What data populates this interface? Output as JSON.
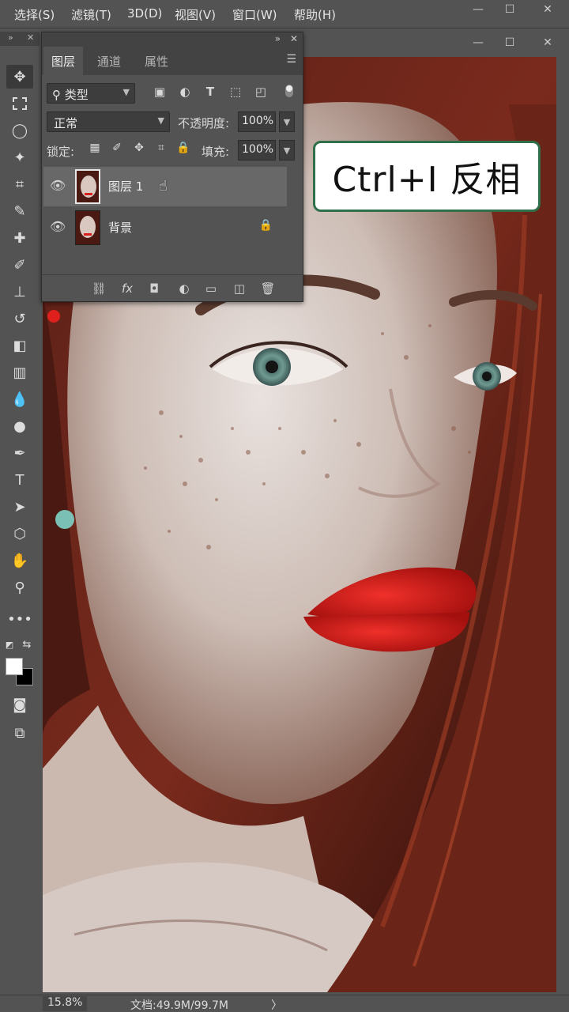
{
  "menubar": {
    "items": [
      "选择(S)",
      "滤镜(T)",
      "3D(D)",
      "视图(V)",
      "窗口(W)",
      "帮助(H)"
    ],
    "controls": [
      "—",
      "☐",
      "✕"
    ]
  },
  "docbar": {
    "controls": [
      "—",
      "☐",
      "✕"
    ]
  },
  "layers_panel": {
    "collapse": "»",
    "close": "✕",
    "tabs": [
      "图层",
      "通道",
      "属性"
    ],
    "filter_kind": "类型",
    "blend_mode": "正常",
    "opacity_label": "不透明度:",
    "opacity_value": "100%",
    "lock_label": "锁定:",
    "fill_label": "填充:",
    "fill_value": "100%",
    "layers": [
      {
        "name": "图层 1",
        "selected": true,
        "visible": true,
        "locked": false
      },
      {
        "name": "背景",
        "selected": false,
        "visible": true,
        "locked": true
      }
    ]
  },
  "callout": {
    "text": "Ctrl+I  反相"
  },
  "statusbar": {
    "zoom": "15.8%",
    "docinfo": "文档:49.9M/99.7M",
    "arrow": "〉"
  },
  "colors": {
    "panel_bg": "#535353",
    "panel_dark": "#434343",
    "selected_layer": "#686868",
    "callout_border": "#2f6f4a",
    "lip_red": "#d8201c"
  }
}
